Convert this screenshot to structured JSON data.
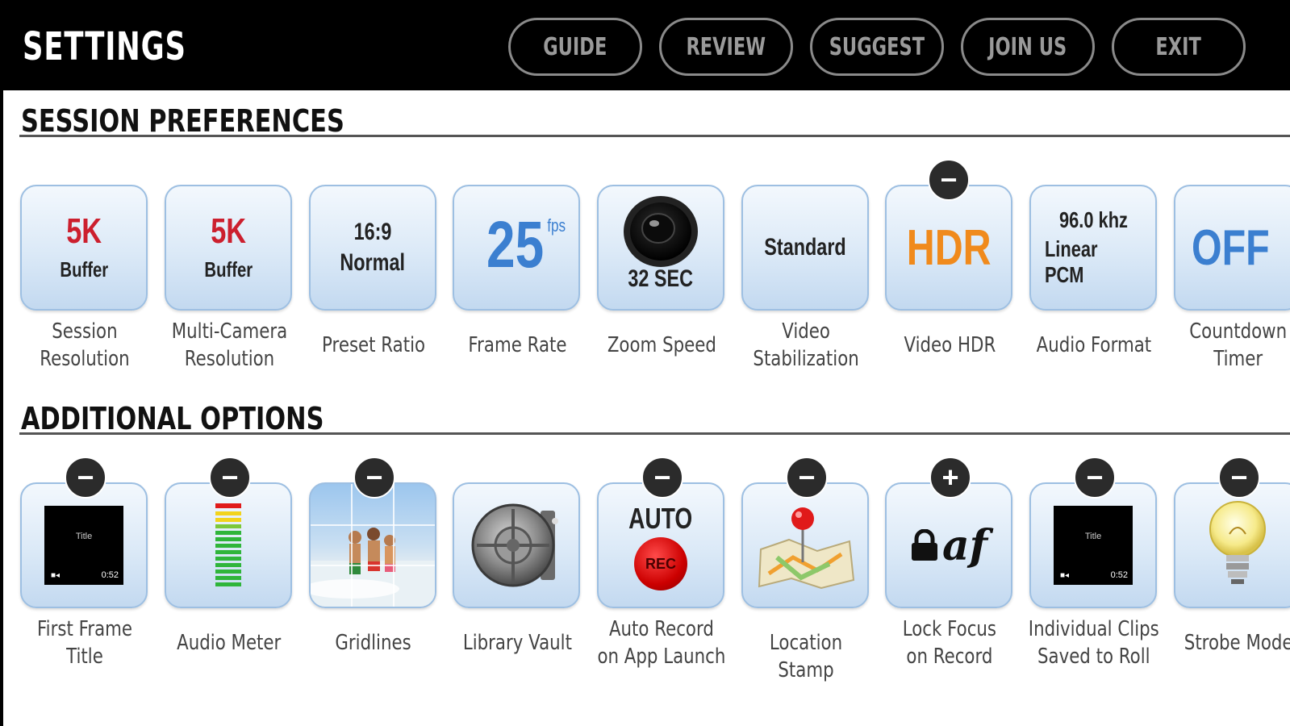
{
  "header": {
    "title": "SETTINGS",
    "nav": [
      "GUIDE",
      "REVIEW",
      "SUGGEST",
      "JOIN US",
      "EXIT"
    ]
  },
  "session": {
    "heading": "SESSION PREFERENCES",
    "items": [
      {
        "line1": "5K",
        "line2": "Buffer",
        "caption": "Session\nResolution"
      },
      {
        "line1": "5K",
        "line2": "Buffer",
        "caption": "Multi-Camera\nResolution"
      },
      {
        "line1": "16:9",
        "line2": "Normal",
        "caption": "Preset Ratio"
      },
      {
        "line1": "25",
        "line2": "fps",
        "caption": "Frame Rate"
      },
      {
        "line1": "32 SEC",
        "caption": "Zoom Speed"
      },
      {
        "line1": "Standard",
        "caption": "Video\nStabilization"
      },
      {
        "line1": "HDR",
        "toggle": "−",
        "caption": "Video HDR"
      },
      {
        "line1": "96.0 khz",
        "line2": "Linear PCM",
        "caption": "Audio Format"
      },
      {
        "line1": "OFF",
        "caption": "Countdown\nTimer"
      }
    ]
  },
  "additional": {
    "heading": "ADDITIONAL OPTIONS",
    "items": [
      {
        "toggle": "−",
        "caption": "First Frame\nTitle",
        "screen_title": "Title",
        "screen_time": "0:52"
      },
      {
        "toggle": "−",
        "caption": "Audio Meter"
      },
      {
        "toggle": "−",
        "caption": "Gridlines"
      },
      {
        "caption": "Library Vault"
      },
      {
        "toggle": "−",
        "line1": "AUTO",
        "line2": "REC",
        "caption": "Auto Record\non App Launch"
      },
      {
        "toggle": "−",
        "caption": "Location Stamp"
      },
      {
        "toggle": "+",
        "line1": "af",
        "caption": "Lock Focus\non Record"
      },
      {
        "toggle": "−",
        "caption": "Individual Clips\nSaved to Roll",
        "screen_title": "Title",
        "screen_time": "0:52"
      },
      {
        "toggle": "−",
        "caption": "Strobe Mode"
      }
    ]
  },
  "colors": {
    "red": "#cc1f2e",
    "blue": "#3b7fd0",
    "orange": "#f08a1c",
    "tile_border": "#9dbfe2"
  }
}
